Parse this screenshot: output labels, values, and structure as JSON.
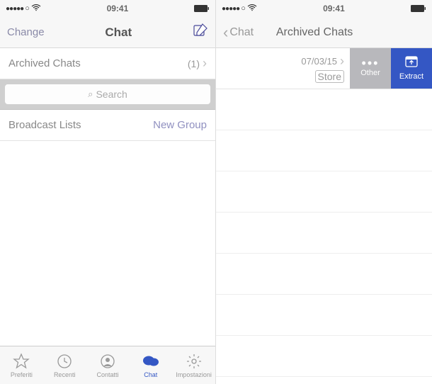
{
  "status": {
    "signal": "●●●●●",
    "carrier_circle": "○",
    "time": "09:41",
    "battery_pct": "100"
  },
  "left_phone": {
    "nav": {
      "left_label": "Change",
      "title": "Chat"
    },
    "archived_row": {
      "label": "Archived Chats",
      "count": "(1)"
    },
    "search": {
      "placeholder": "Search"
    },
    "lists_row": {
      "label": "Broadcast Lists",
      "new_group": "New Group"
    },
    "tabs": {
      "preferiti": "Preferiti",
      "recenti": "Recenti",
      "contatti": "Contatti",
      "chat": "Chat",
      "impostazioni": "Impostazioni"
    }
  },
  "right_phone": {
    "nav": {
      "back_label": "Chat",
      "title": "Archived Chats"
    },
    "item": {
      "date": "07/03/15",
      "store": "Store"
    },
    "actions": {
      "other": "Other",
      "extract": "Extract"
    }
  }
}
